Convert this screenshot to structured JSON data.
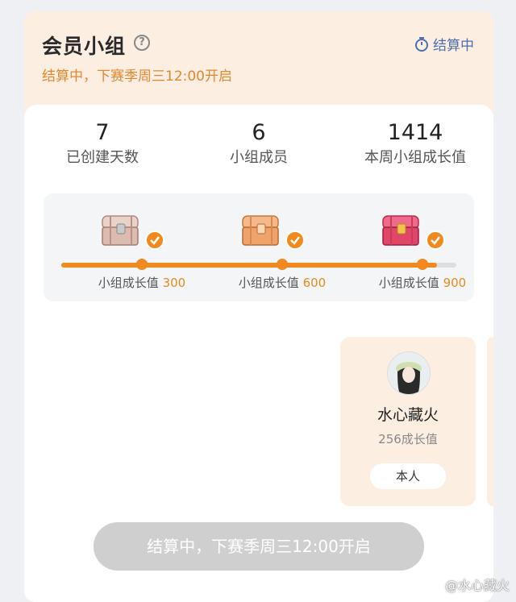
{
  "header": {
    "title": "会员小组",
    "help_icon": "question-circle-icon",
    "status_icon": "timer-icon",
    "status_label": "结算中",
    "subtitle": "结算中，下赛季周三12:00开启"
  },
  "stats": [
    {
      "value": "7",
      "label": "已创建天数"
    },
    {
      "value": "6",
      "label": "小组成员"
    },
    {
      "value": "1414",
      "label": "本周小组成长值"
    }
  ],
  "rewards": {
    "progress_percent": 95,
    "milestones": [
      {
        "label": "小组成长值",
        "value": "300",
        "chest": "silver-chest-icon",
        "claimed": true
      },
      {
        "label": "小组成长值",
        "value": "600",
        "chest": "bronze-chest-icon",
        "claimed": true
      },
      {
        "label": "小组成长值",
        "value": "900",
        "chest": "red-chest-icon",
        "claimed": true
      }
    ]
  },
  "member": {
    "name": "水心藏火",
    "growth": "256成长值",
    "badge": "本人"
  },
  "bottom_button": "结算中，下赛季周三12:00开启",
  "watermark": "@水心藏火",
  "colors": {
    "accent": "#f08a1e",
    "header_bg": "#fdeee2",
    "status_blue": "#4a6fb0",
    "subtitle_orange": "#e2872f"
  }
}
